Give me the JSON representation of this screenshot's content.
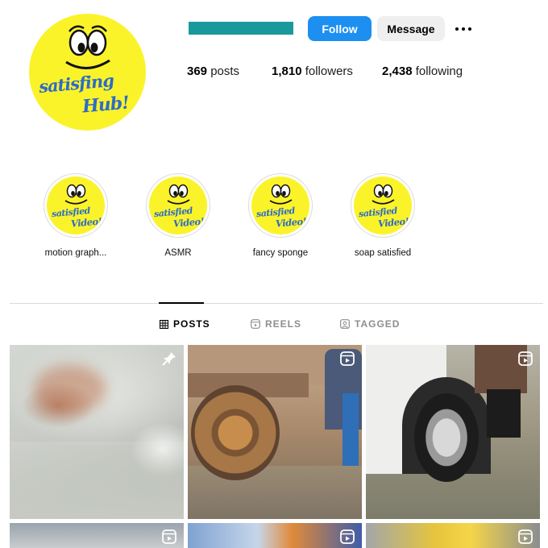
{
  "profile": {
    "avatar_text_line1": "satisfing",
    "avatar_text_line2": "Hub!",
    "username_redacted_color": "#1a999c"
  },
  "actions": {
    "follow_label": "Follow",
    "message_label": "Message",
    "more_icon": "more-horizontal-icon"
  },
  "stats": {
    "posts_count": "369",
    "posts_label": "posts",
    "followers_count": "1,810",
    "followers_label": "followers",
    "following_count": "2,438",
    "following_label": "following"
  },
  "highlights": [
    {
      "label": "motion graph...",
      "cover_line1": "satisfied",
      "cover_line2": "Video!"
    },
    {
      "label": "ASMR",
      "cover_line1": "satisfied",
      "cover_line2": "Video!"
    },
    {
      "label": "fancy sponge",
      "cover_line1": "satisfied",
      "cover_line2": "Video!"
    },
    {
      "label": "soap satisfied",
      "cover_line1": "satisfied",
      "cover_line2": "Video!"
    }
  ],
  "tabs": [
    {
      "label": "POSTS",
      "icon": "grid-icon",
      "active": true
    },
    {
      "label": "REELS",
      "icon": "reels-icon",
      "active": false
    },
    {
      "label": "TAGGED",
      "icon": "tagged-icon",
      "active": false
    }
  ],
  "posts": [
    {
      "badge": "pin-icon"
    },
    {
      "badge": "reel-icon"
    },
    {
      "badge": "reel-icon"
    },
    {
      "badge": "reel-icon"
    },
    {
      "badge": "reel-icon"
    },
    {
      "badge": "reel-icon"
    }
  ],
  "colors": {
    "brand_yellow": "#fbf32a",
    "logo_blue": "#2d6cc6",
    "follow_blue": "#1d8ff0"
  }
}
